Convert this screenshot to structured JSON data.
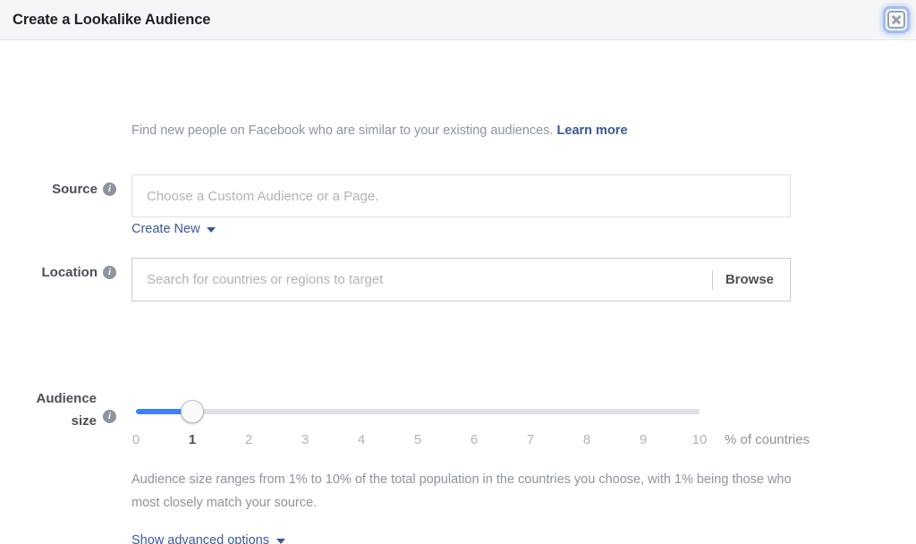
{
  "dialog": {
    "title": "Create a Lookalike Audience",
    "close_icon": "close-icon"
  },
  "intro": {
    "text": "Find new people on Facebook who are similar to your existing audiences.",
    "learn_more": "Learn more"
  },
  "source": {
    "label": "Source",
    "info_glyph": "i",
    "placeholder": "Choose a Custom Audience or a Page.",
    "value": "",
    "create_new": "Create New",
    "caret_icon": "chevron-down-icon"
  },
  "location": {
    "label": "Location",
    "info_glyph": "i",
    "placeholder": "Search for countries or regions to target",
    "value": "",
    "browse": "Browse"
  },
  "audience_size": {
    "label_line1": "Audience",
    "label_line2": "size",
    "info_glyph": "i",
    "value": 1,
    "min": 0,
    "max": 10,
    "ticks": [
      "0",
      "1",
      "2",
      "3",
      "4",
      "5",
      "6",
      "7",
      "8",
      "9",
      "10"
    ],
    "active_tick_index": 1,
    "units": "% of countries",
    "helper_text": "Audience size ranges from 1% to 10% of the total population in the countries you choose, with 1% being those who most closely match your source."
  },
  "advanced": {
    "label": "Show advanced options",
    "caret_icon": "chevron-down-icon"
  },
  "colors": {
    "link": "#3b5998",
    "slider_fill": "#4080ff",
    "header_bg": "#f5f6f7",
    "muted_text": "#8d949e"
  }
}
